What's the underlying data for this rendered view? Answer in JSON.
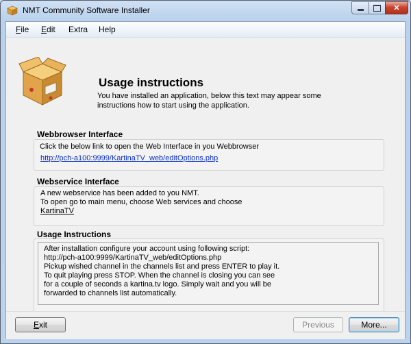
{
  "window": {
    "title": "NMT Community Software Installer"
  },
  "menu": {
    "items": [
      {
        "label": "File",
        "accel": "F",
        "rest": "ile"
      },
      {
        "label": "Edit",
        "accel": "E",
        "rest": "dit"
      },
      {
        "label": "Extra",
        "accel": "",
        "rest": "Extra"
      },
      {
        "label": "Help",
        "accel": "",
        "rest": "Help"
      }
    ]
  },
  "page": {
    "heading": "Usage instructions",
    "intro_line1": "You have installed an application, below this text may appear some",
    "intro_line2": "instructions how to start using the application."
  },
  "webbrowser": {
    "title": "Webbrowser Interface",
    "text": "Click the below link to open the Web Interface in you Webbrowser",
    "link": "http://pch-a100:9999/KartinaTV_web/editOptions.php"
  },
  "webservice": {
    "title": "Webservice Interface",
    "line1": "A new webservice has been added to you NMT.",
    "line2": "To open go to main menu, choose Web services and choose",
    "line3": "KartinaTV"
  },
  "usage": {
    "title": "Usage Instructions",
    "text": "After installation configure your account using following script:\nhttp://pch-a100:9999/KartinaTV_web/editOptions.php\nPickup wished channel in the channels list and press ENTER to play it.\nTo quit playing press STOP. When the channel is closing you can see\nfor a couple of seconds a kartina.tv logo. Simply wait and you will be\nforwarded to channels list automatically."
  },
  "buttons": {
    "exit_accel": "E",
    "exit_rest": "xit",
    "previous": "Previous",
    "more": "More..."
  },
  "colors": {
    "link": "#0a30c0",
    "close_button": "#c8442f"
  }
}
